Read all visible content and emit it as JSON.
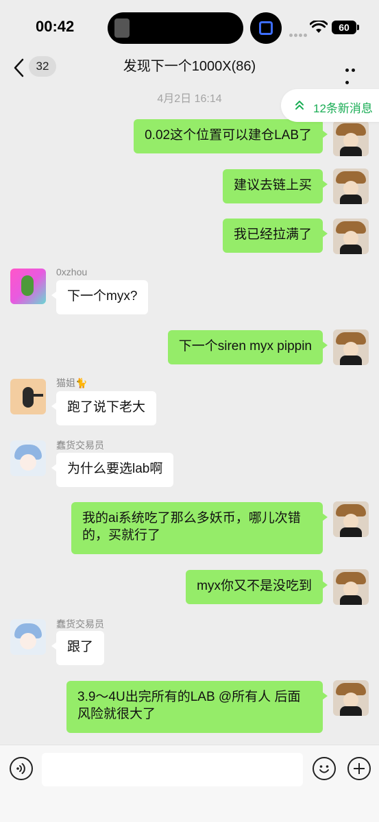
{
  "status_bar": {
    "time": "00:42",
    "battery": "60"
  },
  "nav": {
    "back_count": "32",
    "title": "发现下一个1000X(86)"
  },
  "timestamp": "4月2日 16:14",
  "new_messages": "12条新消息",
  "messages": [
    {
      "side": "me",
      "text": "0.02这个位置可以建仓LAB了"
    },
    {
      "side": "me",
      "text": "建议去链上买"
    },
    {
      "side": "me",
      "text": "我已经拉满了"
    },
    {
      "side": "other",
      "sender": "0xzhou",
      "text": "下一个myx?"
    },
    {
      "side": "me",
      "text": "下一个siren myx pippin"
    },
    {
      "side": "other",
      "sender": "猫姐🐈",
      "text": "跑了说下老大"
    },
    {
      "side": "other",
      "sender": "蠢货交易员",
      "text": "为什么要选lab啊"
    },
    {
      "side": "me",
      "text": "我的ai系统吃了那么多妖币，哪儿次错的，买就行了"
    },
    {
      "side": "me",
      "text": "myx你又不是没吃到"
    },
    {
      "side": "other",
      "sender": "蠢货交易员",
      "text": "跟了"
    },
    {
      "side": "me",
      "text": "3.9～4U出完所有的LAB @所有人 后面风险就很大了"
    }
  ],
  "input": {
    "placeholder": ""
  },
  "colors": {
    "me_bubble": "#95ec69",
    "accent_green": "#1aad55",
    "background": "#ededed"
  },
  "icons": [
    "back-chevron-icon",
    "more-icon",
    "double-chevron-up-icon",
    "voice-icon",
    "emoji-icon",
    "plus-icon",
    "wifi-icon",
    "battery-icon"
  ]
}
